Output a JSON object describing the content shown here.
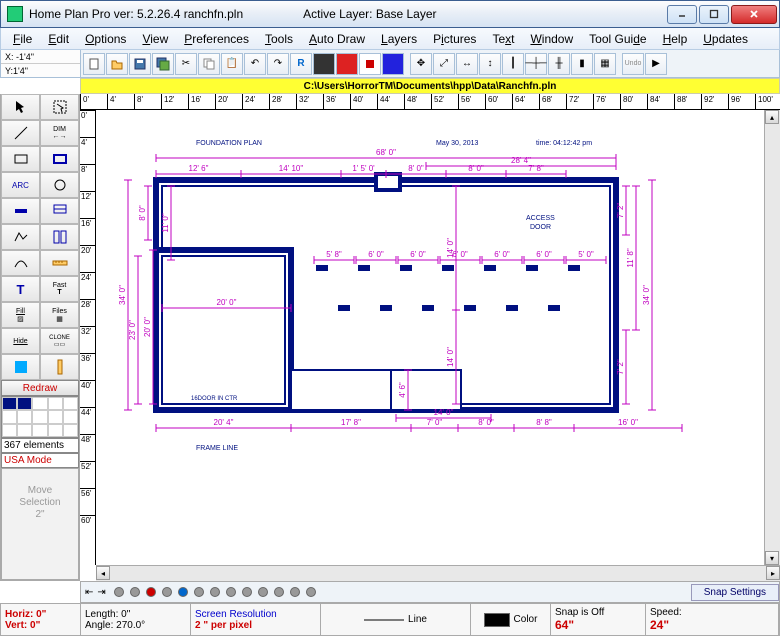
{
  "window": {
    "title_left": "Home Plan Pro ver: 5.2.26.4   ranchfn.pln",
    "title_right": "Active Layer: Base Layer"
  },
  "menus": [
    "File",
    "Edit",
    "Options",
    "View",
    "Preferences",
    "Tools",
    "Auto Draw",
    "Layers",
    "Pictures",
    "Text",
    "Window",
    "Tool Guide",
    "Help",
    "Updates"
  ],
  "coords": {
    "x": "X: -1'4\"",
    "y": "Y:1'4\""
  },
  "path": "C:\\Users\\HorrorTM\\Documents\\hpp\\Data\\Ranchfn.pln",
  "hruler": [
    "0'",
    "4'",
    "8'",
    "12'",
    "16'",
    "20'",
    "24'",
    "28'",
    "32'",
    "36'",
    "40'",
    "44'",
    "48'",
    "52'",
    "56'",
    "60'",
    "64'",
    "68'",
    "72'",
    "76'",
    "80'",
    "84'",
    "88'",
    "92'",
    "96'",
    "100'"
  ],
  "vruler": [
    "0'",
    "4'",
    "8'",
    "12'",
    "16'",
    "20'",
    "24'",
    "28'",
    "32'",
    "36'",
    "40'",
    "44'",
    "48'",
    "52'",
    "56'",
    "60'"
  ],
  "toolbox_rows": [
    [
      "arrow",
      "select"
    ],
    [
      "line",
      "DIM"
    ],
    [
      "rect",
      "rect2"
    ],
    [
      "ARC",
      "circle"
    ],
    [
      "wall1",
      "wall2"
    ],
    [
      "poly",
      "wall3"
    ],
    [
      "curve",
      "ruler"
    ],
    [
      "T",
      "Fast T"
    ],
    [
      "Fill",
      "Files"
    ],
    [
      "Hide",
      "CLONE"
    ],
    [
      "tex",
      "rulerv"
    ]
  ],
  "redraw": "Redraw",
  "elements_count": "367 elements",
  "usa_mode": "USA Mode",
  "move_selection": "Move\nSelection\n2\"",
  "plan": {
    "title": "FOUNDATION PLAN",
    "date": "May 30, 2013",
    "time": "time: 04:12:42 pm",
    "frame_line": "FRAME LINE",
    "access_door": "ACCESS\nDOOR",
    "door_note": "16DOOR IN CTR",
    "dims_top": [
      "68' 0\"",
      "28' 4\""
    ],
    "dims_top2": [
      "12' 6\"",
      "14' 10\"",
      "1' 5' 0'",
      "8' 0\"",
      "8' 0\"",
      "7' 8\""
    ],
    "dims_mid": [
      "5' 8\"",
      "6' 0\"",
      "6' 0\"",
      "6' 0\"",
      "6' 0\"",
      "6' 0\"",
      "5' 0\""
    ],
    "dims_mid2": "20' 0\"",
    "dims_bottom": [
      "20' 4\"",
      "17' 8\"",
      "7' 0\"",
      "8' 0\"",
      "8' 8\"",
      "16' 0\""
    ],
    "dims_bottom2": [
      "14' 0\""
    ],
    "dims_left": [
      "8' 0\"",
      "11' 0\"",
      "20' 0\"",
      "34' 0\"",
      "23' 0\""
    ],
    "dims_right": [
      "7' 2\"",
      "11' 8\"",
      "34' 0\"",
      "7' 2\"",
      "14' 0\"",
      "14' 0\"",
      "4' 6\""
    ]
  },
  "snap_label": "Snap Settings",
  "status": {
    "horiz": "Horiz: 0\"",
    "vert": "Vert:  0\"",
    "length": "Length:  0\"",
    "angle": "Angle:  270.0°",
    "screenres": "Screen Resolution",
    "perpixel": "2 \" per pixel",
    "linetype": "Line",
    "color": "Color",
    "snap": "Snap is Off",
    "snap_val": "64\"",
    "speed": "Speed:",
    "speed_val": "24\""
  }
}
